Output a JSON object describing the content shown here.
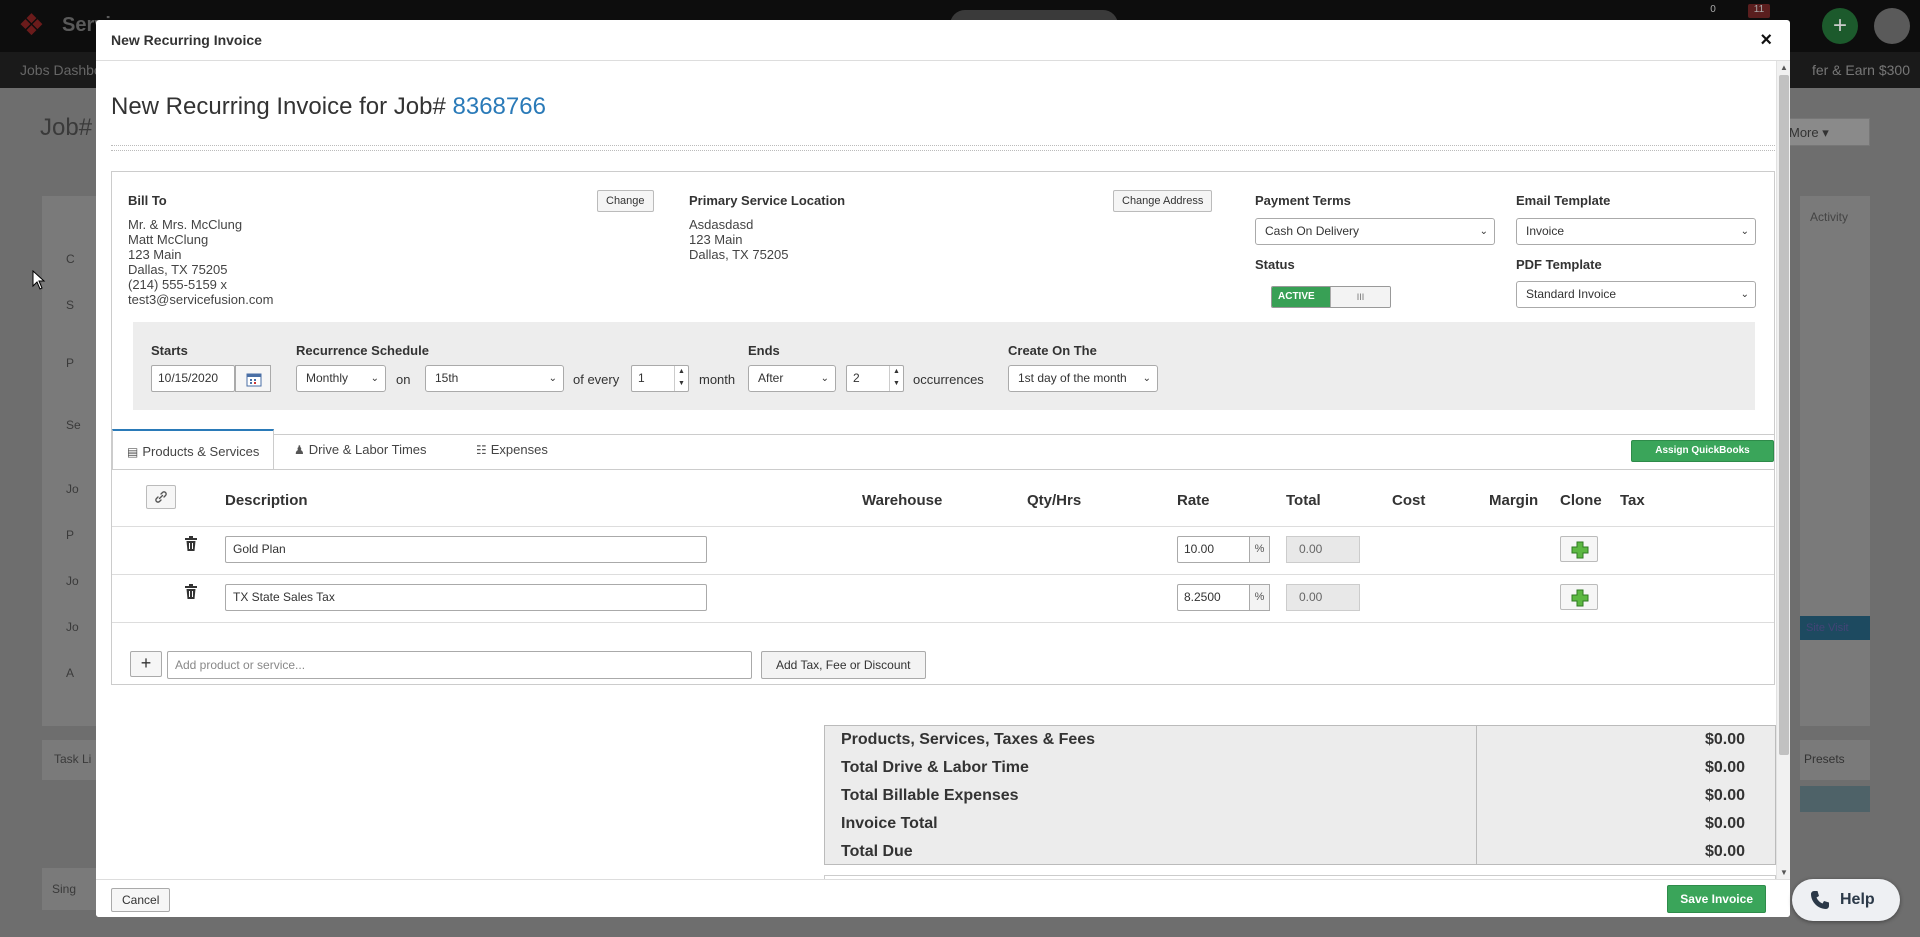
{
  "background": {
    "logo_text": "Servi",
    "badges": [
      "0",
      "11"
    ],
    "nav_left": "Jobs Dashbo",
    "nav_right": "fer & Earn $300",
    "job_title": "Job#",
    "more_label": "More",
    "activity_label": "Activity",
    "site_visit_label": "Site Visit",
    "task_label": "Task Li",
    "presets_label": "Presets",
    "bottom_label": "Sing",
    "side_marks": [
      "C",
      "S",
      "P",
      "Se",
      "Jo",
      "P",
      "Jo",
      "Jo",
      "A"
    ]
  },
  "modal": {
    "title": "New Recurring Invoice",
    "close_label": "×"
  },
  "heading": {
    "prefix": "New Recurring Invoice for Job#",
    "job_number": "8368766"
  },
  "bill_to": {
    "label": "Bill To",
    "change_label": "Change",
    "lines": [
      "Mr. & Mrs. McClung",
      "Matt McClung",
      "123 Main",
      "Dallas, TX 75205",
      "(214) 555-5159 x",
      "test3@servicefusion.com"
    ]
  },
  "service_location": {
    "label": "Primary Service Location",
    "change_label": "Change Address",
    "lines": [
      "Asdasdasd",
      "123 Main",
      "Dallas, TX 75205"
    ]
  },
  "payment_terms": {
    "label": "Payment Terms",
    "value": "Cash On Delivery"
  },
  "email_template": {
    "label": "Email Template",
    "value": "Invoice"
  },
  "status": {
    "label": "Status",
    "value": "ACTIVE",
    "knob": "III"
  },
  "pdf_template": {
    "label": "PDF Template",
    "value": "Standard Invoice"
  },
  "schedule": {
    "starts_label": "Starts",
    "starts_value": "10/15/2020",
    "recurrence_label": "Recurrence Schedule",
    "frequency": "Monthly",
    "on_text": "on",
    "day": "15th",
    "of_every_text": "of every",
    "interval": "1",
    "month_text": "month",
    "ends_label": "Ends",
    "ends_value": "After",
    "occurrences_value": "2",
    "occurrences_text": "occurrences",
    "create_label": "Create On The",
    "create_value": "1st day of the month"
  },
  "tabs": [
    {
      "label": "Products & Services"
    },
    {
      "label": "Drive & Labor Times"
    },
    {
      "label": "Expenses"
    }
  ],
  "assign_label": "Assign QuickBooks Classes",
  "columns": [
    "Description",
    "Warehouse",
    "Qty/Hrs",
    "Rate",
    "Total",
    "Cost",
    "Margin",
    "Clone",
    "Tax"
  ],
  "rows": [
    {
      "description": "Gold Plan",
      "rate": "10.00",
      "rate_unit": "%",
      "total": "0.00"
    },
    {
      "description": "TX State Sales Tax",
      "rate": "8.2500",
      "rate_unit": "%",
      "total": "0.00"
    }
  ],
  "add_row": {
    "plus": "+",
    "placeholder": "Add product or service...",
    "add_tax_label": "Add Tax, Fee or Discount"
  },
  "totals": [
    {
      "label": "Products, Services, Taxes & Fees",
      "value": "$0.00"
    },
    {
      "label": "Total Drive & Labor Time",
      "value": "$0.00"
    },
    {
      "label": "Total Billable Expenses",
      "value": "$0.00"
    },
    {
      "label": "Invoice Total",
      "value": "$0.00"
    },
    {
      "label": "Total Due",
      "value": "$0.00"
    }
  ],
  "footer": {
    "cancel_label": "Cancel",
    "save_label": "Save Invoice"
  },
  "help_label": "Help",
  "colors": {
    "accent_green": "#3aa55a",
    "link_blue": "#2a7ab8"
  }
}
